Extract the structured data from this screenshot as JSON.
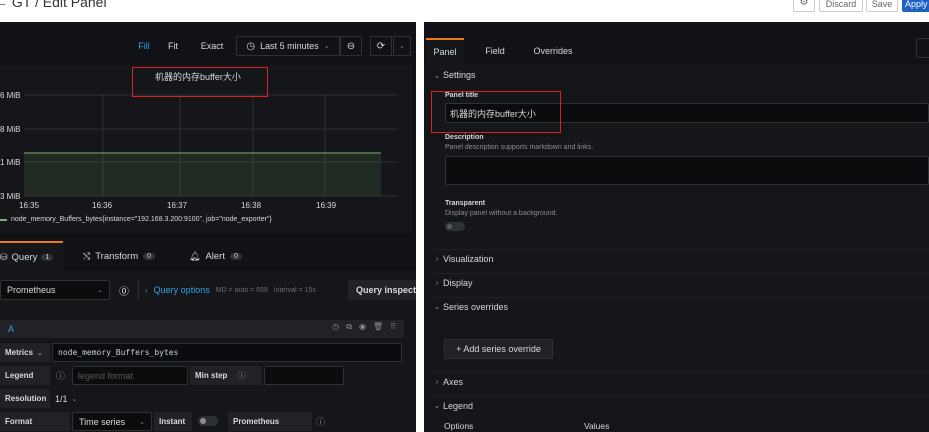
{
  "header": {
    "title": "← GT / Edit Panel",
    "discard_label": "Discard",
    "save_label": "Save",
    "apply_label": "Apply"
  },
  "toolbar": {
    "fill_label": "Fill",
    "fit_label": "Fit",
    "exact_label": "Exact",
    "time_range_label": "Last 5 minutes"
  },
  "graph": {
    "title": "机器的内存buffer大小",
    "y_labels": [
      "6 MiB",
      "8 MiB",
      "1 MiB",
      "3 MiB"
    ],
    "x_labels": [
      "16:35",
      "16:36",
      "16:37",
      "16:38",
      "16:39"
    ],
    "legend": "node_memory_Buffers_bytes{instance=\"192.168.3.200:9100\", job=\"node_exporter\"}",
    "series_color": "#7eb26d"
  },
  "query_tabs": [
    {
      "label": "Query",
      "count": "1"
    },
    {
      "label": "Transform",
      "count": "0"
    },
    {
      "label": "Alert",
      "count": "0"
    }
  ],
  "query": {
    "datasource": "Prometheus",
    "options_label": "Query options",
    "options_info": "MD = auto = 659   Interval = 15s",
    "inspector_label": "Query inspect",
    "ref_id": "A",
    "metrics_label": "Metrics",
    "metrics_value": "node_memory_Buffers_bytes",
    "legend_label": "Legend",
    "legend_placeholder": "legend format",
    "min_step_label": "Min step",
    "resolution_label": "Resolution",
    "resolution_value": "1/1",
    "format_label": "Format",
    "format_value": "Time series",
    "instant_label": "Instant",
    "prometheus_label": "Prometheus"
  },
  "right_tabs": [
    "Panel",
    "Field",
    "Overrides"
  ],
  "settings": {
    "header": "Settings",
    "panel_title_label": "Panel title",
    "panel_title_value": "机器的内存buffer大小",
    "description_label": "Description",
    "description_hint": "Panel description supports markdown and links.",
    "transparent_label": "Transparent",
    "transparent_hint": "Display panel without a background."
  },
  "sections": {
    "visualization": "Visualization",
    "display": "Display",
    "series_overrides": "Series overrides",
    "add_override": "+ Add series override",
    "axes": "Axes",
    "legend": "Legend",
    "options": "Options",
    "values": "Values"
  }
}
